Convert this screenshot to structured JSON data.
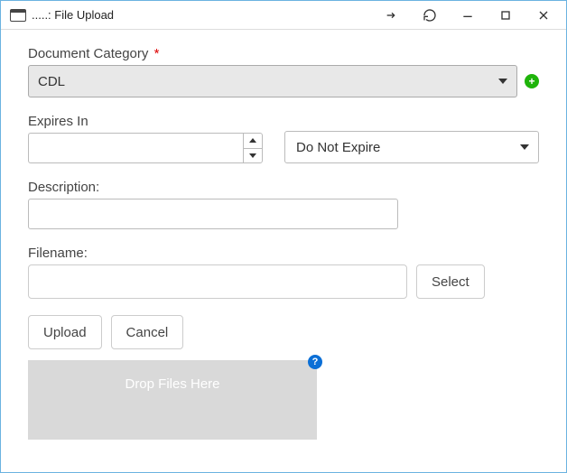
{
  "window": {
    "title": ".....: File Upload"
  },
  "form": {
    "document_category": {
      "label": "Document Category",
      "required_mark": "*",
      "value": "CDL"
    },
    "expires_in": {
      "label": "Expires In",
      "value": "",
      "unit_selected": "Do Not Expire"
    },
    "description": {
      "label": "Description:",
      "value": ""
    },
    "filename": {
      "label": "Filename:",
      "value": "",
      "select_button": "Select"
    },
    "buttons": {
      "upload": "Upload",
      "cancel": "Cancel"
    },
    "dropzone": {
      "text": "Drop Files Here",
      "help": "?"
    },
    "add_icon": "+"
  }
}
